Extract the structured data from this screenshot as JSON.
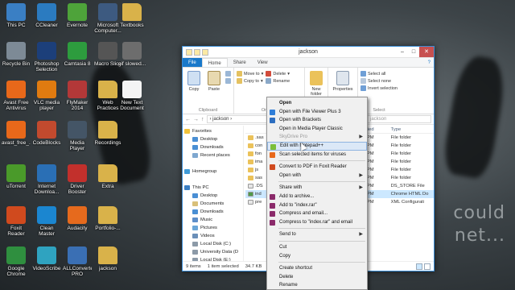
{
  "wallpaper": {
    "text_line1": "could",
    "text_line2": "net..."
  },
  "desktop_icons": [
    {
      "label": "This PC",
      "icon": "computer-icon",
      "color": "#3a7fc4"
    },
    {
      "label": "Recycle Bin",
      "icon": "recycle-bin-icon",
      "color": "#7d8a96"
    },
    {
      "label": "Avast Free Antivirus",
      "icon": "avast-icon",
      "color": "#e8681a"
    },
    {
      "label": "avast_free_...",
      "icon": "installer-icon",
      "color": "#e8681a"
    },
    {
      "label": "uTorrent",
      "icon": "utorrent-icon",
      "color": "#4a9a2a"
    },
    {
      "label": "Foxit Reader",
      "icon": "foxit-icon",
      "color": "#d04a1e"
    },
    {
      "label": "Google Chrome",
      "icon": "chrome-icon",
      "color": "#2f8f3f"
    },
    {
      "label": "CCleaner",
      "icon": "ccleaner-icon",
      "color": "#2b7bc0"
    },
    {
      "label": "Photoshop Selection",
      "icon": "photoshop-icon",
      "color": "#1c3f7a"
    },
    {
      "label": "VLC media player",
      "icon": "vlc-icon",
      "color": "#e07b10"
    },
    {
      "label": "CodeBlocks",
      "icon": "codeblocks-icon",
      "color": "#c24a2e"
    },
    {
      "label": "Internet Downloa...",
      "icon": "idm-icon",
      "color": "#2a6fb5"
    },
    {
      "label": "Clean Master",
      "icon": "cleanmaster-icon",
      "color": "#1b86d0"
    },
    {
      "label": "VideoScribe",
      "icon": "videoscribe-icon",
      "color": "#2fa3c0"
    },
    {
      "label": "Evernote",
      "icon": "evernote-icon",
      "color": "#4ea33a"
    },
    {
      "label": "Camtasia 8",
      "icon": "camtasia-icon",
      "color": "#2d9c3e"
    },
    {
      "label": "FlyMaker 2014 Khutbat",
      "icon": "app-icon",
      "color": "#b33838"
    },
    {
      "label": "Media Player Classic",
      "icon": "mpc-icon",
      "color": "#445566"
    },
    {
      "label": "Driver Booster",
      "icon": "driverbooster-icon",
      "color": "#c2302c"
    },
    {
      "label": "Audacity",
      "icon": "audacity-icon",
      "color": "#e66a1d"
    },
    {
      "label": "ALLConverter PRO",
      "icon": "converter-icon",
      "color": "#3a6fb4"
    },
    {
      "label": "Microsoft Computer...",
      "icon": "app-icon",
      "color": "#3d5a80"
    },
    {
      "label": "Macro Slice",
      "icon": "app-icon",
      "color": "#555555"
    },
    {
      "label": "Web Practices",
      "icon": "folder-icon",
      "color": "#d9b24a"
    },
    {
      "label": "Recordings",
      "icon": "folder-icon",
      "color": "#d9b24a"
    },
    {
      "label": "Extra",
      "icon": "folder-icon",
      "color": "#d9b24a"
    },
    {
      "label": "Portfolio-...",
      "icon": "folder-icon",
      "color": "#d9b24a"
    },
    {
      "label": "jackson",
      "icon": "folder-icon",
      "color": "#d9b24a"
    },
    {
      "label": "Textbooks",
      "icon": "folder-icon",
      "color": "#d9b24a"
    },
    {
      "label": "gif slowed...",
      "icon": "file-icon",
      "color": "#6d6d6d"
    },
    {
      "label": "New Text Document",
      "icon": "text-file-icon",
      "color": "#f4f4f4"
    }
  ],
  "window": {
    "title": "jackson",
    "tabs": {
      "file": "File",
      "home": "Home",
      "share": "Share",
      "view": "View"
    },
    "ribbon": {
      "copy": "Copy",
      "paste": "Paste",
      "clipboard_group": "Clipboard",
      "move_to": "Move to",
      "copy_to": "Copy to",
      "delete": "Delete",
      "rename": "Rename",
      "organize_group": "Organiz",
      "new_folder": "New folder",
      "properties": "Properties",
      "select_all": "Select all",
      "select_none": "Select none",
      "invert_selection": "Invert selection",
      "select_group": "Select"
    },
    "address": {
      "path": "› jackson ›",
      "search_placeholder": "jackson"
    },
    "navpane": {
      "favorites": "Favorites",
      "desktop": "Desktop",
      "downloads": "Downloads",
      "recent_places": "Recent places",
      "homegroup": "Homegroup",
      "this_pc": "This PC",
      "pc_desktop": "Desktop",
      "documents": "Documents",
      "pc_downloads": "Downloads",
      "music": "Music",
      "pictures": "Pictures",
      "videos": "Videos",
      "local_c": "Local Disk (C:)",
      "university": "University Data (D",
      "local_e": "Local Disk (E:)",
      "local_f": "Local Disk (F:)"
    },
    "columns": {
      "name": "",
      "date": "ified",
      "type": "Type"
    },
    "files": [
      {
        "name": ".sas",
        "date": "40 PM",
        "type": "File folder",
        "icon": "folder-icon"
      },
      {
        "name": "con",
        "date": "40 PM",
        "type": "File folder",
        "icon": "folder-icon"
      },
      {
        "name": "fon",
        "date": "40 PM",
        "type": "File folder",
        "icon": "folder-icon"
      },
      {
        "name": "ima",
        "date": "40 PM",
        "type": "File folder",
        "icon": "folder-icon"
      },
      {
        "name": "js",
        "date": "40 PM",
        "type": "File folder",
        "icon": "folder-icon"
      },
      {
        "name": "sas",
        "date": "40 PM",
        "type": "File folder",
        "icon": "folder-icon"
      },
      {
        "name": ".DS",
        "date": "6:52 PM",
        "type": "DS_STORE File",
        "icon": "file-icon"
      },
      {
        "name": "ind",
        "date": "6:52 PM",
        "type": "Chrome HTML Do",
        "icon": "chrome-doc-icon"
      },
      {
        "name": "pre",
        "date": "6:52 PM",
        "type": "XML Configurati",
        "icon": "file-icon"
      }
    ],
    "status": {
      "items": "9 items",
      "selected": "1 item selected",
      "size": "34.7 KB"
    }
  },
  "context_menu": {
    "items": [
      {
        "label": "Open",
        "style": "bold",
        "icon": ""
      },
      {
        "label": "Open with File Viewer Plus 3",
        "style": "",
        "icon": "fileviewer-icon",
        "color": "#2f7ed8"
      },
      {
        "label": "Open with Brackets",
        "style": "",
        "icon": "brackets-icon",
        "color": "#2d6ec0"
      },
      {
        "label": "Open in Media Player Classic",
        "style": "",
        "icon": ""
      },
      {
        "label": "SkyDrive Pro",
        "style": "disabled",
        "icon": "",
        "submenu": true
      },
      {
        "label": "Edit with Notepad++",
        "style": "highlight",
        "icon": "notepadpp-icon",
        "color": "#7bbf3a"
      },
      {
        "label": "Scan selected items for viruses",
        "style": "",
        "icon": "avast-icon",
        "color": "#e8681a"
      },
      {
        "sep": true
      },
      {
        "label": "Convert to PDF in Foxit Reader",
        "style": "",
        "icon": "foxit-icon",
        "color": "#d04a1e"
      },
      {
        "label": "Open with",
        "style": "",
        "icon": "",
        "submenu": true
      },
      {
        "sep": true
      },
      {
        "label": "Share with",
        "style": "",
        "icon": "",
        "submenu": true
      },
      {
        "label": "Add to archive...",
        "style": "",
        "icon": "winrar-icon",
        "color": "#8b2a6a"
      },
      {
        "label": "Add to \"index.rar\"",
        "style": "",
        "icon": "winrar-icon",
        "color": "#8b2a6a"
      },
      {
        "label": "Compress and email...",
        "style": "",
        "icon": "winrar-icon",
        "color": "#8b2a6a"
      },
      {
        "label": "Compress to \"index.rar\" and email",
        "style": "",
        "icon": "winrar-icon",
        "color": "#8b2a6a"
      },
      {
        "sep": true
      },
      {
        "label": "Send to",
        "style": "",
        "icon": "",
        "submenu": true
      },
      {
        "sep": true
      },
      {
        "label": "Cut",
        "style": "",
        "icon": ""
      },
      {
        "label": "Copy",
        "style": "",
        "icon": ""
      },
      {
        "sep": true
      },
      {
        "label": "Create shortcut",
        "style": "",
        "icon": ""
      },
      {
        "label": "Delete",
        "style": "",
        "icon": ""
      },
      {
        "label": "Rename",
        "style": "",
        "icon": ""
      },
      {
        "sep": true
      },
      {
        "label": "Properties",
        "style": "",
        "icon": ""
      }
    ]
  },
  "colors": {
    "accent": "#1979ca",
    "selection": "#cce8ff",
    "close_button": "#c75050"
  }
}
